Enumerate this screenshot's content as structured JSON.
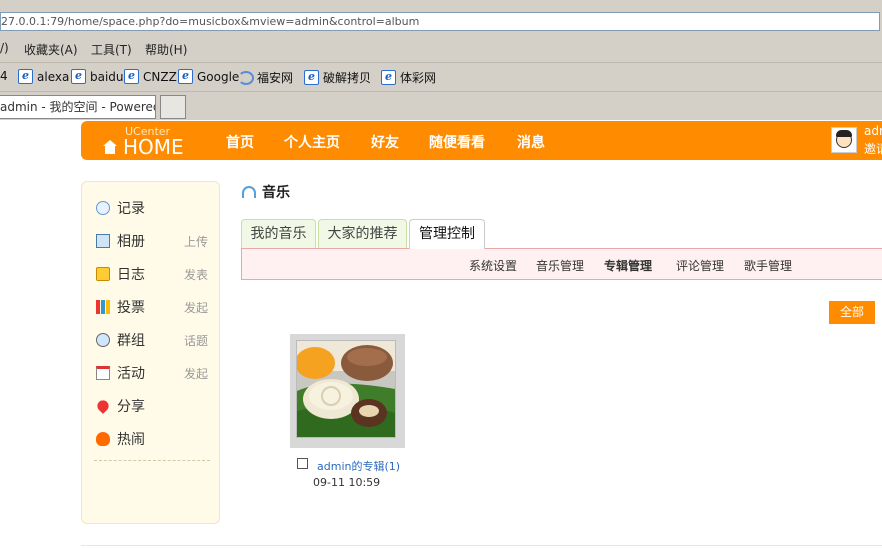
{
  "browser": {
    "address": "27.0.0.1:79/home/space.php?do=musicbox&mview=admin&control=album",
    "menu": [
      "/)",
      "收藏夹(A)",
      "工具(T)",
      "帮助(H)"
    ],
    "bookmarks": [
      "4",
      "alexa",
      "baidu",
      "CNZZ",
      "Google",
      "福安网",
      "破解拷贝",
      "体彩网"
    ],
    "tab_title": "admin - 我的空间 - Powered ..."
  },
  "header": {
    "logo_small": "UCenter",
    "logo_big": "HOME",
    "nav": [
      "首页",
      "个人主页",
      "好友",
      "随便看看",
      "消息"
    ],
    "user_name": "adr",
    "user_invite": "邀请"
  },
  "sidebar": {
    "items": [
      {
        "label": "记录",
        "extra": ""
      },
      {
        "label": "相册",
        "extra": "上传"
      },
      {
        "label": "日志",
        "extra": "发表"
      },
      {
        "label": "投票",
        "extra": "发起"
      },
      {
        "label": "群组",
        "extra": "话题"
      },
      {
        "label": "活动",
        "extra": "发起"
      },
      {
        "label": "分享",
        "extra": ""
      },
      {
        "label": "热闹",
        "extra": ""
      }
    ]
  },
  "main": {
    "title": "音乐",
    "tabs": [
      "我的音乐",
      "大家的推荐",
      "管理控制"
    ],
    "subnav": [
      "系统设置",
      "音乐管理",
      "专辑管理",
      "评论管理",
      "歌手管理"
    ],
    "all_button": "全部",
    "album": {
      "name": "admin的专辑(1)",
      "date": "09-11 10:59"
    }
  },
  "colors": {
    "accent": "#ff8c00",
    "sidebar_bg": "#fffbe8",
    "subnav_bg": "#fff1f1",
    "link": "#2a6ac0"
  }
}
